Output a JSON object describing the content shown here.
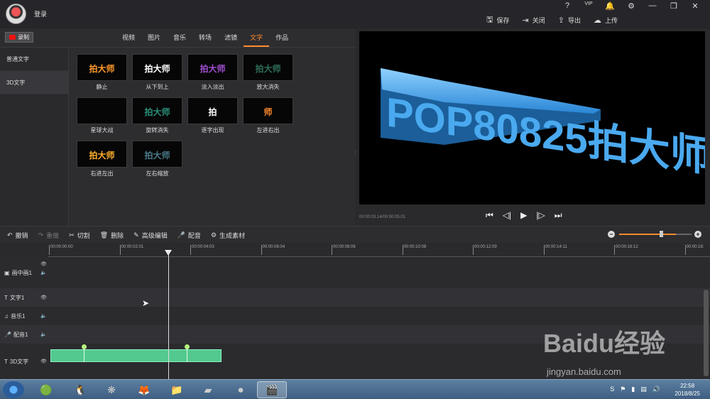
{
  "titlebar": {
    "login": "登录",
    "sys_icons": [
      "?",
      "VIP",
      "🔔",
      "⚙",
      "—",
      "❐",
      "✕"
    ],
    "actions": [
      {
        "icon": "save-icon",
        "glyph": "🖫",
        "label": "保存"
      },
      {
        "icon": "close-project-icon",
        "glyph": "⇥",
        "label": "关闭"
      },
      {
        "icon": "export-icon",
        "glyph": "⇪",
        "label": "导出"
      },
      {
        "icon": "upload-icon",
        "glyph": "☁",
        "label": "上传"
      }
    ]
  },
  "record_label": "录制",
  "tabs": [
    "视频",
    "图片",
    "音乐",
    "转场",
    "滤镜",
    "文字",
    "作品"
  ],
  "active_tab": "文字",
  "sidebar": [
    {
      "label": "普通文字"
    },
    {
      "label": "3D文字"
    }
  ],
  "effects": [
    {
      "label": "静止",
      "text": "拍大师",
      "color": "#ff9a2a"
    },
    {
      "label": "从下到上",
      "text": "拍大师",
      "color": "#ffffff"
    },
    {
      "label": "淡入淡出",
      "text": "拍大师",
      "color": "#a24fd0"
    },
    {
      "label": "放大消失",
      "text": "拍大师",
      "color": "#2f6f5a"
    },
    {
      "label": "星球大战",
      "text": "",
      "color": "#ff8a2a"
    },
    {
      "label": "旋转消失",
      "text": "拍大师",
      "color": "#2a8f7a"
    },
    {
      "label": "逐字出现",
      "text": "拍",
      "color": "#ffffff"
    },
    {
      "label": "左进右出",
      "text": "师",
      "color": "#ff8a2a"
    },
    {
      "label": "右进左出",
      "text": "拍大师",
      "color": "#ffb02a"
    },
    {
      "label": "左右缩放",
      "text": "拍大师",
      "color": "#4a7a8a"
    }
  ],
  "preview": {
    "text_3d": "POP80825拍大师",
    "time": "00:00:03.14/00:00:05.01",
    "controls": [
      "⏮",
      "◁|",
      "▶",
      "|▷",
      "⏭"
    ]
  },
  "toolbar": [
    {
      "label": "撤销",
      "glyph": "↶",
      "icon": "undo-icon",
      "enabled": true
    },
    {
      "label": "重做",
      "glyph": "↷",
      "icon": "redo-icon",
      "enabled": false
    },
    {
      "label": "切割",
      "glyph": "✂",
      "icon": "cut-icon",
      "enabled": true
    },
    {
      "label": "删除",
      "glyph": "🗑",
      "icon": "delete-icon",
      "enabled": true
    },
    {
      "label": "高级编辑",
      "glyph": "✎",
      "icon": "edit-icon",
      "enabled": true
    },
    {
      "label": "配音",
      "glyph": "🎤",
      "icon": "mic-icon",
      "enabled": true
    },
    {
      "label": "生成素材",
      "glyph": "⚙",
      "icon": "generate-icon",
      "enabled": true
    }
  ],
  "zoom_level": 0.75,
  "ruler_ticks": [
    "00:00:00:00",
    "00:00:02:01",
    "00:00:04:03",
    "00:00:06:04",
    "00:00:08:06",
    "00:00:10:08",
    "00:00:12:09",
    "00:00:14:11",
    "00:00:16:12",
    "00:00:18:"
  ],
  "tracks": [
    {
      "label": "画中画1",
      "glyph": "▣"
    },
    {
      "label": "文字1",
      "glyph": "T"
    },
    {
      "label": "音乐1",
      "glyph": "♫"
    },
    {
      "label": "配音1",
      "glyph": "🎤"
    },
    {
      "label": "3D文字",
      "glyph": "T"
    }
  ],
  "taskbar": {
    "clock_time": "22:58",
    "clock_date": "2018/8/25"
  },
  "watermark": {
    "main": "Baidu经验",
    "sub": "jingyan.baidu.com"
  }
}
